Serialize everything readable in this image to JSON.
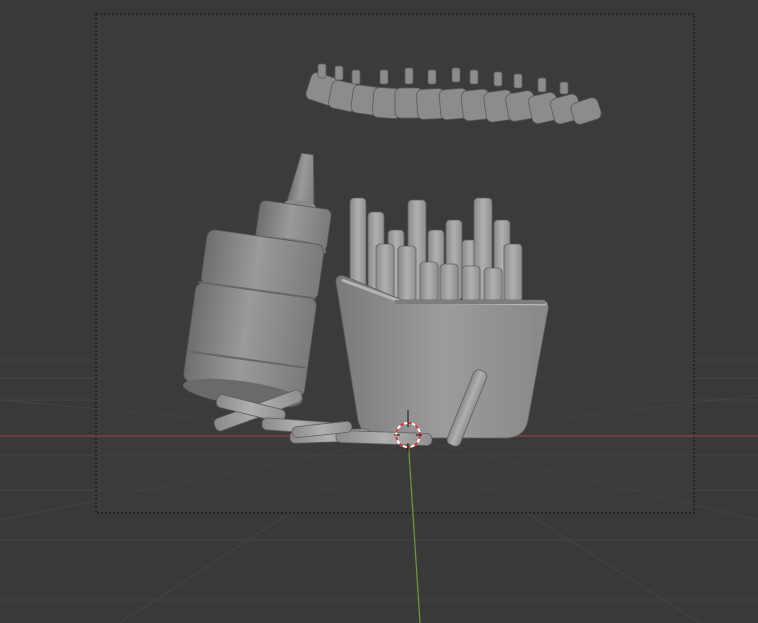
{
  "viewport": {
    "colors": {
      "background": "#393939",
      "camera_frame_fill": "#3e3e3e",
      "camera_frame_border": "#0d0d0d",
      "grid_line": "#454545",
      "x_axis": "#9a3d47",
      "y_axis": "#6f9a38",
      "cursor_red": "#e03030",
      "mesh": "#8e8e8e"
    },
    "objects": [
      "ketchup-bottle",
      "fries-box",
      "loose-fries",
      "fries-row"
    ],
    "icons": {
      "cursor": "3d-cursor-icon"
    }
  }
}
